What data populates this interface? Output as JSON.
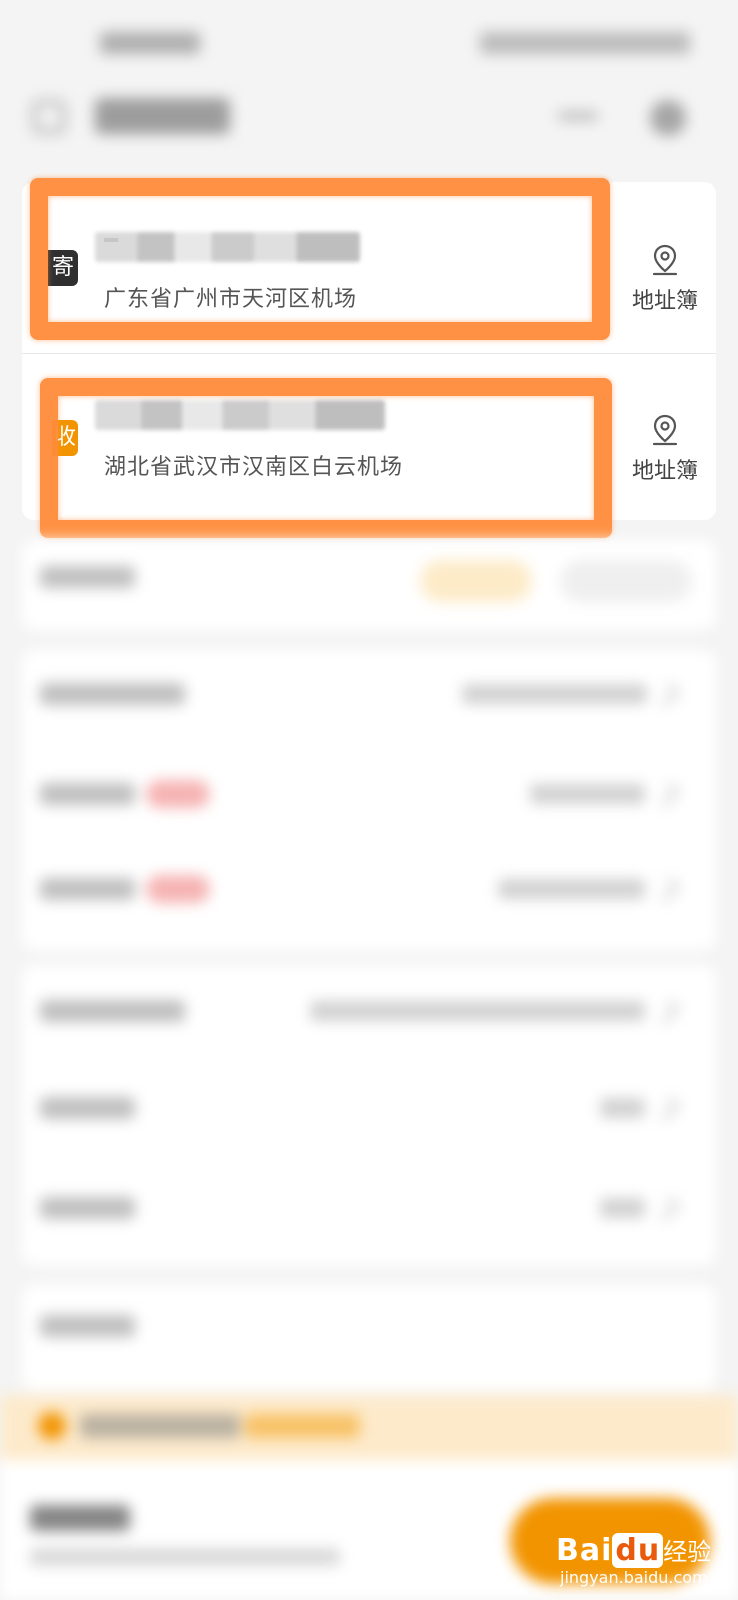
{
  "address_card": {
    "sender": {
      "tag": "寄",
      "address": "广东省广州市天河区机场",
      "address_book_label": "地址簿"
    },
    "receiver": {
      "tag": "收",
      "address": "湖北省武汉市汉南区白云机场",
      "address_book_label": "地址簿"
    }
  },
  "watermark": {
    "logo_bai": "Bai",
    "logo_du": "du",
    "logo_cn": "经验",
    "url": "jingyan.baidu.com"
  },
  "colors": {
    "highlight": "#ff8c3a",
    "receiver_tag": "#f29400",
    "sender_tag": "#2f2f2f",
    "accent": "#f29400"
  },
  "icons": {
    "address_book": "location-pin-icon",
    "home": "home-icon",
    "more": "more-dots-icon",
    "settings": "target-icon"
  }
}
